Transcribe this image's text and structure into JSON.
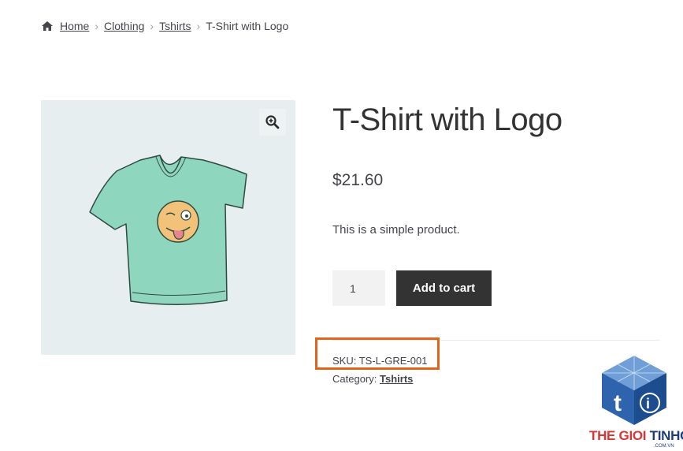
{
  "breadcrumb": {
    "home": "Home",
    "level1": "Clothing",
    "level2": "Tshirts",
    "current": "T-Shirt with Logo",
    "separator": "›"
  },
  "product": {
    "title": "T-Shirt with Logo",
    "price": "$21.60",
    "description": "This is a simple product.",
    "quantity": "1",
    "add_to_cart_label": "Add to cart",
    "sku_label": "SKU:",
    "sku_value": "TS-L-GRE-001",
    "category_label": "Category:",
    "category_value": "Tshirts"
  },
  "icons": {
    "home": "home-icon",
    "zoom": "magnifier-plus-icon"
  },
  "watermark": {
    "part1": "THE GIOI",
    "part2": "TINHOC",
    "sub": ".COM.VN"
  },
  "colors": {
    "highlight": "#e0651a",
    "button_bg": "#333333",
    "gallery_bg": "#e6eef0",
    "shirt": "#8fd6be"
  }
}
